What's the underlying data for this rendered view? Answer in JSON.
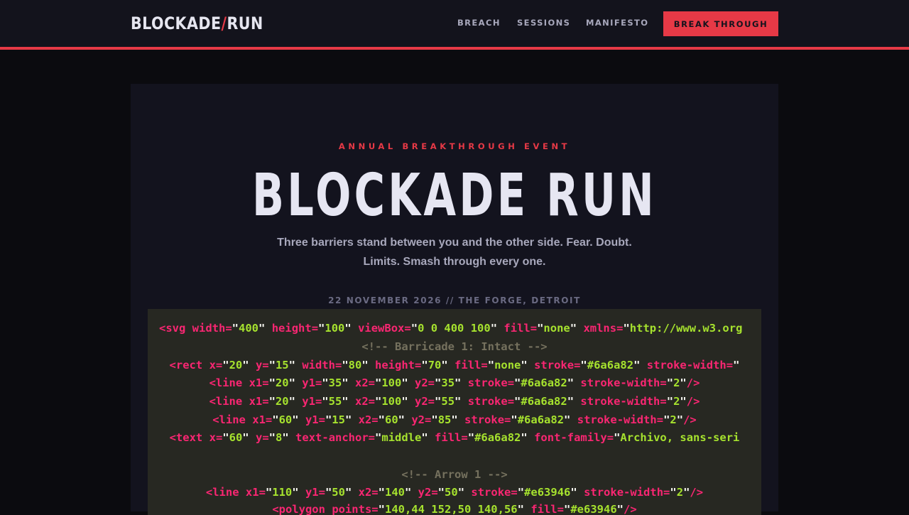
{
  "brand": {
    "logo_left": "BLOCKADE",
    "logo_slash": "/",
    "logo_right": "RUN",
    "accent": "#e63946"
  },
  "nav": {
    "links": [
      "BREACH",
      "SESSIONS",
      "MANIFESTO"
    ],
    "cta": "BREAK THROUGH"
  },
  "hero": {
    "eyebrow": "ANNUAL BREAKTHROUGH EVENT",
    "title": "BLOCKADE RUN",
    "tagline_line1": "Three barriers stand between you and the other side. Fear. Doubt.",
    "tagline_line2": "Limits. Smash through every one.",
    "meta": "22 NOVEMBER 2026 // THE FORGE, DETROIT"
  },
  "code_block": {
    "lines": [
      "<svg width=\"400\" height=\"100\" viewBox=\"0 0 400 100\" fill=\"none\" xmlns=\"http://www.w3.org",
      "<!-- Barricade 1: Intact -->",
      "<rect x=\"20\" y=\"15\" width=\"80\" height=\"70\" fill=\"none\" stroke=\"#6a6a82\" stroke-width=\"",
      "<line x1=\"20\" y1=\"35\" x2=\"100\" y2=\"35\" stroke=\"#6a6a82\" stroke-width=\"2\"/>",
      "<line x1=\"20\" y1=\"55\" x2=\"100\" y2=\"55\" stroke=\"#6a6a82\" stroke-width=\"2\"/>",
      "<line x1=\"60\" y1=\"15\" x2=\"60\" y2=\"85\" stroke=\"#6a6a82\" stroke-width=\"2\"/>",
      "<text x=\"60\" y=\"8\" text-anchor=\"middle\" fill=\"#6a6a82\" font-family=\"Archivo, sans-seri",
      "",
      "<!-- Arrow 1 -->",
      "<line x1=\"110\" y1=\"50\" x2=\"140\" y2=\"50\" stroke=\"#e63946\" stroke-width=\"2\"/>",
      "<polygon points=\"140,44 152,50 140,56\" fill=\"#e63946\"/>"
    ]
  }
}
